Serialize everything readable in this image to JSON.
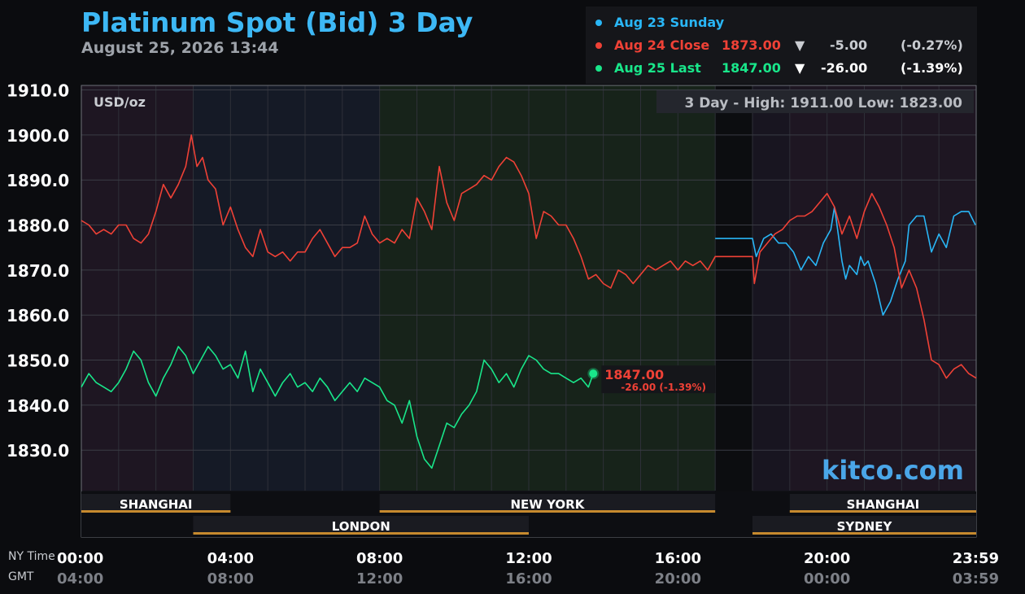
{
  "header": {
    "title": "Platinum Spot (Bid) 3 Day",
    "subtitle": "August 25, 2026 13:44"
  },
  "legend": {
    "rows": [
      {
        "label": "Aug 23 Sunday",
        "price": "",
        "arrow": "",
        "change": "",
        "pct": "",
        "color": "#29b6f6",
        "text_color": "#29b6f6"
      },
      {
        "label": "Aug 24 Close",
        "price": "1873.00",
        "arrow": "▼",
        "change": "-5.00",
        "pct": "(-0.27%)",
        "color": "#ef4136",
        "text_color": "#ef4136"
      },
      {
        "label": "Aug 25 Last",
        "price": "1847.00",
        "arrow": "▼",
        "change": "-26.00",
        "pct": "(-1.39%)",
        "color": "#19e68a",
        "text_color": "#19e68a"
      }
    ]
  },
  "chart_data": {
    "type": "line",
    "title": "Platinum Spot (Bid) 3 Day",
    "ylabel": "USD/oz",
    "ylim": [
      1821,
      1911
    ],
    "yticks": [
      "1910.0",
      "1900.0",
      "1890.0",
      "1880.0",
      "1870.0",
      "1860.0",
      "1850.0",
      "1840.0",
      "1830.0"
    ],
    "xlim": [
      0,
      24
    ],
    "x_labels_ny": [
      "00:00",
      "04:00",
      "08:00",
      "12:00",
      "16:00",
      "20:00",
      "23:59"
    ],
    "x_labels_gmt": [
      "04:00",
      "08:00",
      "12:00",
      "16:00",
      "20:00",
      "00:00",
      "03:59"
    ],
    "x_row_labels": [
      "NY Time",
      "GMT"
    ],
    "unit_label": "USD/oz",
    "high_low_text": "3 Day - High: 1911.00  Low: 1823.00",
    "watermark": "kitco.com",
    "last_point": {
      "x": 13.73,
      "y": 1847.0,
      "price": "1847.00",
      "change": "-26.00 (-1.39%)"
    },
    "grid": true,
    "series": [
      {
        "name": "Aug 23 Sunday",
        "color": "#29b6f6",
        "x": [
          17.0,
          18.0,
          18.1,
          18.3,
          18.5,
          18.7,
          18.9,
          19.1,
          19.3,
          19.5,
          19.7,
          19.9,
          20.1,
          20.2,
          20.4,
          20.5,
          20.6,
          20.8,
          20.9,
          21.0,
          21.1,
          21.3,
          21.5,
          21.7,
          21.9,
          22.1,
          22.2,
          22.4,
          22.6,
          22.8,
          23.0,
          23.2,
          23.4,
          23.6,
          23.8,
          23.98
        ],
        "y": [
          1877,
          1877,
          1873,
          1877,
          1878,
          1876,
          1876,
          1874,
          1870,
          1873,
          1871,
          1876,
          1879,
          1884,
          1872,
          1868,
          1871,
          1869,
          1873,
          1871,
          1872,
          1867,
          1860,
          1863,
          1868,
          1872,
          1880,
          1882,
          1882,
          1874,
          1878,
          1875,
          1882,
          1883,
          1883,
          1880
        ]
      },
      {
        "name": "Aug 24 Close",
        "color": "#ef4136",
        "x": [
          0.0,
          0.2,
          0.4,
          0.6,
          0.8,
          1.0,
          1.2,
          1.4,
          1.6,
          1.8,
          2.0,
          2.2,
          2.4,
          2.6,
          2.8,
          2.95,
          3.1,
          3.25,
          3.4,
          3.6,
          3.8,
          4.0,
          4.2,
          4.4,
          4.6,
          4.8,
          5.0,
          5.2,
          5.4,
          5.6,
          5.8,
          6.0,
          6.2,
          6.4,
          6.6,
          6.8,
          7.0,
          7.2,
          7.4,
          7.6,
          7.8,
          8.0,
          8.2,
          8.4,
          8.6,
          8.8,
          9.0,
          9.2,
          9.4,
          9.6,
          9.8,
          10.0,
          10.2,
          10.4,
          10.6,
          10.8,
          11.0,
          11.2,
          11.4,
          11.6,
          11.8,
          12.0,
          12.2,
          12.4,
          12.6,
          12.8,
          13.0,
          13.2,
          13.4,
          13.6,
          13.8,
          14.0,
          14.2,
          14.4,
          14.6,
          14.8,
          15.0,
          15.2,
          15.4,
          15.6,
          15.8,
          16.0,
          16.2,
          16.4,
          16.6,
          16.8,
          17.0,
          18.0,
          18.05,
          18.2,
          18.4,
          18.6,
          18.8,
          19.0,
          19.2,
          19.4,
          19.6,
          19.8,
          20.0,
          20.2,
          20.4,
          20.6,
          20.8,
          21.0,
          21.2,
          21.4,
          21.6,
          21.8,
          22.0,
          22.2,
          22.4,
          22.6,
          22.8,
          23.0,
          23.2,
          23.4,
          23.6,
          23.8,
          24.0
        ],
        "y": [
          1881,
          1880,
          1878,
          1879,
          1878,
          1880,
          1880,
          1877,
          1876,
          1878,
          1883,
          1889,
          1886,
          1889,
          1893,
          1900,
          1893,
          1895,
          1890,
          1888,
          1880,
          1884,
          1879,
          1875,
          1873,
          1879,
          1874,
          1873,
          1874,
          1872,
          1874,
          1874,
          1877,
          1879,
          1876,
          1873,
          1875,
          1875,
          1876,
          1882,
          1878,
          1876,
          1877,
          1876,
          1879,
          1877,
          1886,
          1883,
          1879,
          1893,
          1885,
          1881,
          1887,
          1888,
          1889,
          1891,
          1890,
          1893,
          1895,
          1894,
          1891,
          1887,
          1877,
          1883,
          1882,
          1880,
          1880,
          1877,
          1873,
          1868,
          1869,
          1867,
          1866,
          1870,
          1869,
          1867,
          1869,
          1871,
          1870,
          1871,
          1872,
          1870,
          1872,
          1871,
          1872,
          1870,
          1873,
          1873,
          1867,
          1874,
          1876,
          1878,
          1879,
          1881,
          1882,
          1882,
          1883,
          1885,
          1887,
          1884,
          1878,
          1882,
          1877,
          1883,
          1887,
          1884,
          1880,
          1875,
          1866,
          1870,
          1866,
          1859,
          1850,
          1849,
          1846,
          1848,
          1849,
          1847,
          1846
        ]
      },
      {
        "name": "Aug 25 Last",
        "color": "#19e68a",
        "x": [
          0.0,
          0.2,
          0.4,
          0.6,
          0.8,
          1.0,
          1.2,
          1.4,
          1.6,
          1.8,
          2.0,
          2.2,
          2.4,
          2.6,
          2.8,
          3.0,
          3.2,
          3.4,
          3.6,
          3.8,
          4.0,
          4.2,
          4.4,
          4.6,
          4.8,
          5.0,
          5.2,
          5.4,
          5.6,
          5.8,
          6.0,
          6.2,
          6.4,
          6.6,
          6.8,
          7.0,
          7.2,
          7.4,
          7.6,
          7.8,
          8.0,
          8.2,
          8.4,
          8.6,
          8.8,
          9.0,
          9.2,
          9.4,
          9.6,
          9.8,
          10.0,
          10.2,
          10.4,
          10.6,
          10.8,
          11.0,
          11.2,
          11.4,
          11.6,
          11.8,
          12.0,
          12.2,
          12.4,
          12.6,
          12.8,
          13.0,
          13.2,
          13.4,
          13.6,
          13.73
        ],
        "y": [
          1844,
          1847,
          1845,
          1844,
          1843,
          1845,
          1848,
          1852,
          1850,
          1845,
          1842,
          1846,
          1849,
          1853,
          1851,
          1847,
          1850,
          1853,
          1851,
          1848,
          1849,
          1846,
          1852,
          1843,
          1848,
          1845,
          1842,
          1845,
          1847,
          1844,
          1845,
          1843,
          1846,
          1844,
          1841,
          1843,
          1845,
          1843,
          1846,
          1845,
          1844,
          1841,
          1840,
          1836,
          1841,
          1833,
          1828,
          1826,
          1831,
          1836,
          1835,
          1838,
          1840,
          1843,
          1850,
          1848,
          1845,
          1847,
          1844,
          1848,
          1851,
          1850,
          1848,
          1847,
          1847,
          1846,
          1845,
          1846,
          1844,
          1847
        ]
      }
    ],
    "sessions": [
      {
        "name": "SHANGHAI",
        "start": 0.0,
        "end": 4.0,
        "row": 1,
        "shade": "#1e1622"
      },
      {
        "name": "LONDON",
        "start": 3.0,
        "end": 12.0,
        "row": 2,
        "shade": "#151a26"
      },
      {
        "name": "NEW YORK",
        "start": 8.0,
        "end": 17.0,
        "row": 1,
        "shade": "#17231a"
      },
      {
        "name": "SYDNEY",
        "start": 18.0,
        "end": 24.0,
        "row": 2,
        "shade": "#181520"
      },
      {
        "name": "SHANGHAI",
        "start": 19.0,
        "end": 24.0,
        "row": 1,
        "shade": "#1e1622"
      }
    ]
  }
}
